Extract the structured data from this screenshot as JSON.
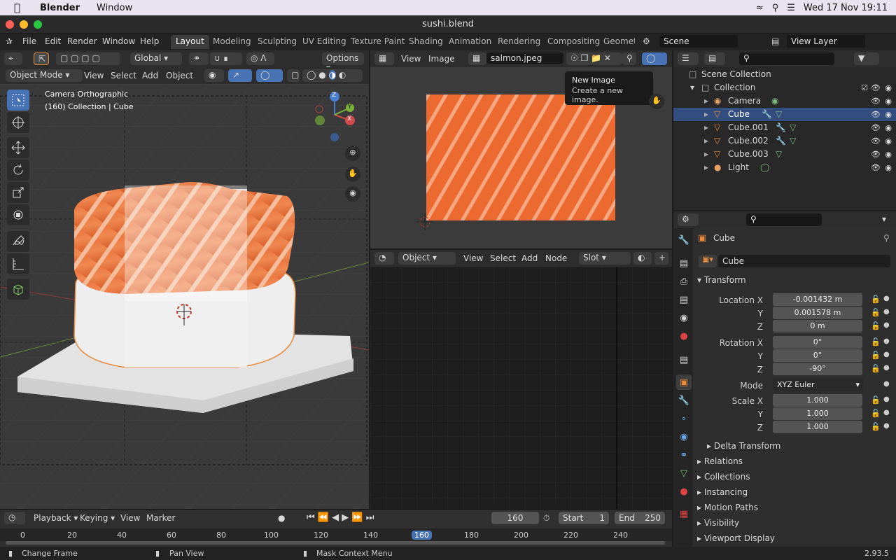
{
  "macbar": {
    "app": "Blender",
    "menu_window": "Window",
    "datetime": "Wed 17 Nov  19:11"
  },
  "window": {
    "title": "sushi.blend"
  },
  "topmenu": [
    "File",
    "Edit",
    "Render",
    "Window",
    "Help"
  ],
  "workspaces": [
    "Layout",
    "Modeling",
    "Sculpting",
    "UV Editing",
    "Texture Paint",
    "Shading",
    "Animation",
    "Rendering",
    "Compositing",
    "Geometr"
  ],
  "scene": {
    "name": "Scene",
    "view_layer": "View Layer"
  },
  "viewport": {
    "orientation": "Global",
    "options_label": "Options",
    "mode": "Object Mode",
    "menus": [
      "View",
      "Select",
      "Add",
      "Object"
    ],
    "overlay_title": "Camera Orthographic",
    "overlay_sub": "(160) Collection | Cube",
    "gizmo_axes": {
      "x": "X",
      "y": "Y",
      "z": "Z"
    }
  },
  "image_editor": {
    "menus": [
      "View",
      "Image"
    ],
    "image_name": "salmon.jpeg",
    "tooltip_title": "New Image",
    "tooltip_desc": "Create a new image."
  },
  "node_editor": {
    "context": "Object",
    "menus": [
      "View",
      "Select",
      "Add",
      "Node"
    ],
    "slot": "Slot"
  },
  "outliner": {
    "root": "Scene Collection",
    "collection": "Collection",
    "items": [
      "Camera",
      "Cube",
      "Cube.001",
      "Cube.002",
      "Cube.003",
      "Light"
    ],
    "selected": "Cube"
  },
  "properties": {
    "object_name": "Cube",
    "data_name": "Cube",
    "transform_label": "Transform",
    "location": {
      "label": "Location X",
      "x": "-0.001432 m",
      "y": "0.001578 m",
      "z": "0 m"
    },
    "rotation": {
      "label": "Rotation X",
      "x": "0°",
      "y": "0°",
      "z": "-90°"
    },
    "mode": {
      "label": "Mode",
      "value": "XYZ Euler"
    },
    "scale": {
      "label": "Scale X",
      "x": "1.000",
      "y": "1.000",
      "z": "1.000"
    },
    "axis_y": "Y",
    "axis_z": "Z",
    "sections": [
      "Delta Transform",
      "Relations",
      "Collections",
      "Instancing",
      "Motion Paths",
      "Visibility",
      "Viewport Display"
    ]
  },
  "timeline": {
    "menus": [
      "Playback",
      "Keying",
      "View",
      "Marker"
    ],
    "current_frame": "160",
    "start_label": "Start",
    "start": "1",
    "end_label": "End",
    "end": "250",
    "ticks": [
      "0",
      "20",
      "40",
      "60",
      "80",
      "100",
      "120",
      "140",
      "160",
      "180",
      "200",
      "220",
      "240"
    ]
  },
  "status": {
    "left": "Change Frame",
    "mid": "Pan View",
    "right": "Mask Context Menu",
    "version": "2.93.5"
  },
  "colors": {
    "accent": "#4772b3",
    "selected_row": "#334d80",
    "orange": "#e88a3c"
  }
}
